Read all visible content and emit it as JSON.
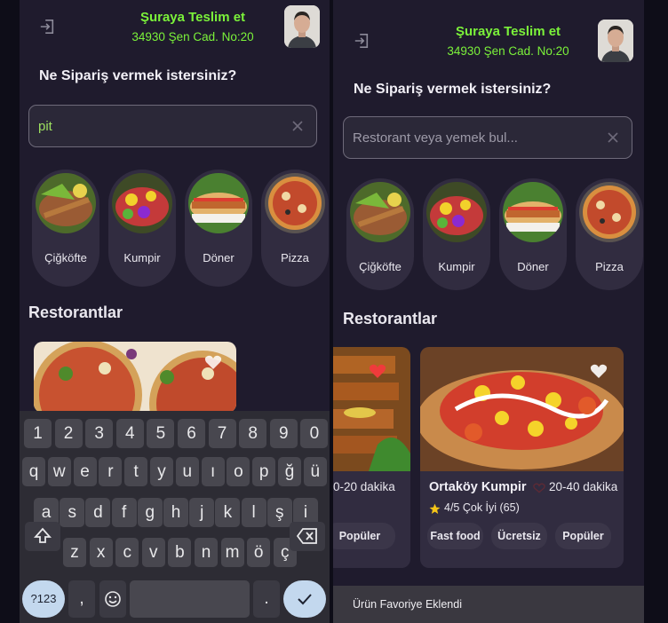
{
  "header": {
    "deliver_title": "Şuraya Teslim et",
    "address": "34930 Şen Cad. No:20"
  },
  "question": "Ne Sipariş vermek istersiniz?",
  "search": {
    "left_value": "pit",
    "placeholder": "Restorant veya yemek bul..."
  },
  "categories": [
    {
      "label": "Çiğköfte",
      "icon": "cigkofte-image"
    },
    {
      "label": "Kumpir",
      "icon": "kumpir-image"
    },
    {
      "label": "Döner",
      "icon": "doner-image"
    },
    {
      "label": "Pizza",
      "icon": "pizza-image"
    }
  ],
  "restaurants_title": "Restorantlar",
  "restaurants": [
    {
      "time_partial": "0-20 dakika",
      "tags": [
        "Popüler"
      ]
    },
    {
      "name": "Ortaköy Kumpir",
      "time": "20-40 dakika",
      "rating": "4/5 Çok İyi (65)",
      "tags": [
        "Fast food",
        "Ücretsiz",
        "Popüler"
      ]
    }
  ],
  "keyboard": {
    "row_numbers": [
      "1",
      "2",
      "3",
      "4",
      "5",
      "6",
      "7",
      "8",
      "9",
      "0"
    ],
    "row1": [
      "q",
      "w",
      "e",
      "r",
      "t",
      "y",
      "u",
      "ı",
      "o",
      "p",
      "ğ",
      "ü"
    ],
    "row2": [
      "a",
      "s",
      "d",
      "f",
      "g",
      "h",
      "j",
      "k",
      "l",
      "ş",
      "i"
    ],
    "row3": [
      "z",
      "x",
      "c",
      "v",
      "b",
      "n",
      "m",
      "ö",
      "ç"
    ],
    "symbols_label": "?123",
    "comma": ",",
    "period": "."
  },
  "snackbar": "Ürün Favoriye Eklendi",
  "colors": {
    "accent": "#7bf23a",
    "background": "#1f1b2d",
    "card": "#312c40",
    "heart_red": "#ef3b3b"
  }
}
